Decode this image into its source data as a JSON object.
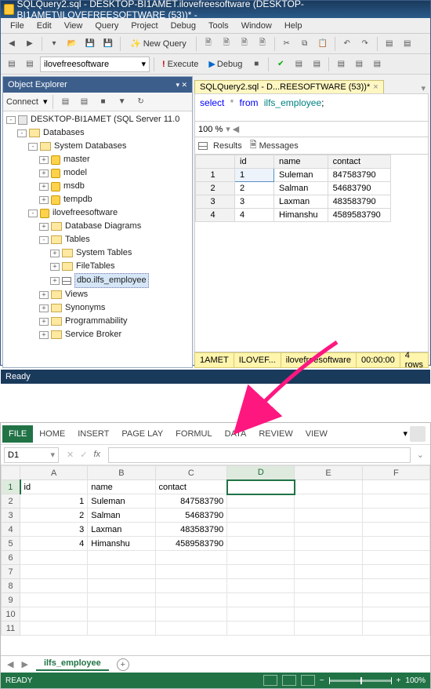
{
  "ssms": {
    "title": "SQLQuery2.sql - DESKTOP-BI1AMET.ilovefreesoftware (DESKTOP-BI1AMET\\ILOVEFREESOFTWARE (53))* -",
    "menu": [
      "File",
      "Edit",
      "View",
      "Query",
      "Project",
      "Debug",
      "Tools",
      "Window",
      "Help"
    ],
    "newquery_label": "New Query",
    "db_selected": "ilovefreesoftware",
    "execute_label": "Execute",
    "debug_label": "Debug",
    "obj_explorer_title": "Object Explorer",
    "connect_label": "Connect",
    "tree": {
      "server": "DESKTOP-BI1AMET (SQL Server 11.0",
      "databases": "Databases",
      "sysdb": "System Databases",
      "master": "master",
      "model": "model",
      "msdb": "msdb",
      "tempdb": "tempdb",
      "userdb": "ilovefreesoftware",
      "dbdiag": "Database Diagrams",
      "tables": "Tables",
      "systables": "System Tables",
      "filetables": "FileTables",
      "emp_table": "dbo.ilfs_employee",
      "views": "Views",
      "synonyms": "Synonyms",
      "prog": "Programmability",
      "svcbroker": "Service Broker"
    },
    "doc_tab": "SQLQuery2.sql - D...REESOFTWARE (53))*",
    "sql_keywords": {
      "select": "select",
      "star": "*",
      "from": "from"
    },
    "sql_table": "ilfs_employee",
    "zoom": "100 %",
    "results_tab": "Results",
    "messages_tab": "Messages",
    "grid": {
      "headers": [
        "id",
        "name",
        "contact"
      ],
      "rows": [
        {
          "n": "1",
          "id": "1",
          "name": "Suleman",
          "contact": "847583790"
        },
        {
          "n": "2",
          "id": "2",
          "name": "Salman",
          "contact": "54683790"
        },
        {
          "n": "3",
          "id": "3",
          "name": "Laxman",
          "contact": "483583790"
        },
        {
          "n": "4",
          "id": "4",
          "name": "Himanshu",
          "contact": "4589583790"
        }
      ]
    },
    "status": {
      "srv": "1AMET",
      "login": "ILOVEF...",
      "db": "ilovefreesoftware",
      "time": "00:00:00",
      "rows": "4 rows"
    },
    "ready": "Ready"
  },
  "excel": {
    "tabs": [
      "FILE",
      "HOME",
      "INSERT",
      "PAGE LAY",
      "FORMUL",
      "DATA",
      "REVIEW",
      "VIEW"
    ],
    "active_tab": "FILE",
    "namebox": "D1",
    "fx_label": "fx",
    "cols": [
      "A",
      "B",
      "C",
      "D",
      "E",
      "F"
    ],
    "rows": [
      {
        "r": "1",
        "A": "id",
        "B": "name",
        "C": "contact"
      },
      {
        "r": "2",
        "A": "1",
        "B": "Suleman",
        "C": "847583790"
      },
      {
        "r": "3",
        "A": "2",
        "B": "Salman",
        "C": "54683790"
      },
      {
        "r": "4",
        "A": "3",
        "B": "Laxman",
        "C": "483583790"
      },
      {
        "r": "5",
        "A": "4",
        "B": "Himanshu",
        "C": "4589583790"
      },
      {
        "r": "6"
      },
      {
        "r": "7"
      },
      {
        "r": "8"
      },
      {
        "r": "9"
      },
      {
        "r": "10"
      },
      {
        "r": "11"
      }
    ],
    "sheet_tab": "ilfs_employee",
    "status_ready": "READY",
    "zoom_pct": "100%"
  }
}
